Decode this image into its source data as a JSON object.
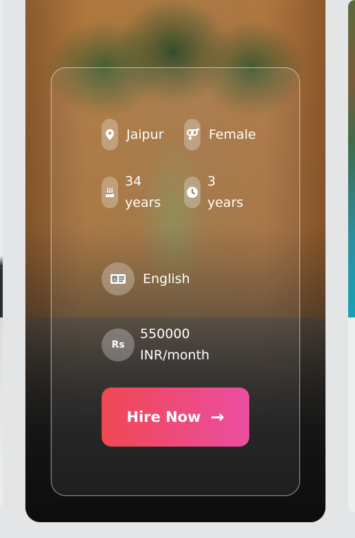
{
  "profile": {
    "city": "Jaipur",
    "gender": "Female",
    "age_value": "34",
    "age_unit": "years",
    "experience_value": "3",
    "experience_unit": "years",
    "language": "English",
    "salary_amount": "550000",
    "salary_unit": "INR/month",
    "currency_badge": "Rs"
  },
  "actions": {
    "hire_label": "Hire Now",
    "hire_arrow": "→"
  },
  "icons": [
    "location-pin-icon",
    "gender-icon",
    "birthday-cake-icon",
    "clock-icon",
    "language-icon",
    "rupee-icon",
    "arrow-right-icon"
  ]
}
